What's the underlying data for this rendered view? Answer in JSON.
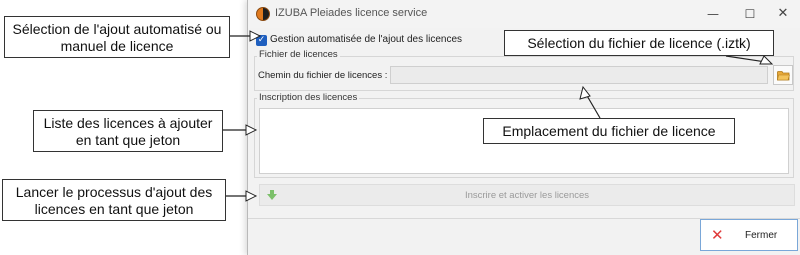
{
  "window": {
    "title": "IZUBA Pleiades licence service",
    "controls": {
      "minimize": "—",
      "maximize": "☐",
      "close": "✕"
    }
  },
  "auto_manage": {
    "label": "Gestion automatisée de l'ajout des licences",
    "checked": true,
    "check_glyph": "✓"
  },
  "license_file_group": {
    "title": "Fichier de licences",
    "path_label": "Chemin du fichier de licences :",
    "path_value": "",
    "browse_icon": "folder-icon"
  },
  "registration_group": {
    "title": "Inscription des licences"
  },
  "register_button": {
    "label": "Inscrire et activer les licences",
    "icon": "green-arrow-down-icon"
  },
  "close_button": {
    "label": "Fermer",
    "icon": "red-x-icon",
    "glyph": "✕"
  },
  "callouts": {
    "auto_select": "Sélection de l'ajout automatisé ou manuel de licence",
    "file_select": "Sélection du fichier de licence (.iztk)",
    "license_list": "Liste des licences à ajouter en tant que jeton",
    "file_location": "Emplacement du fichier de licence",
    "add_process": "Lancer le processus d'ajout des licences en tant que jeton"
  },
  "colors": {
    "accent": "#1f5fbf",
    "close_icon": "#e03a3a",
    "register_icon": "#7cc06a",
    "folder_icon": "#e8a93a"
  }
}
